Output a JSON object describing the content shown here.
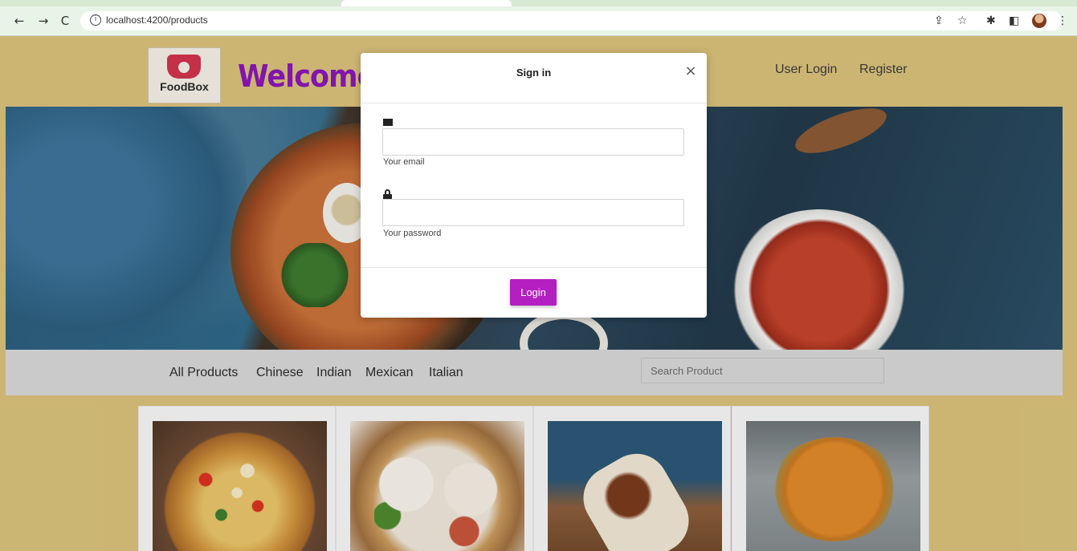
{
  "browser": {
    "back_icon": "arrow-left-icon",
    "forward_icon": "arrow-right-icon",
    "reload_icon": "reload-icon",
    "url": "localhost:4200/products",
    "share_icon": "share-icon",
    "bookmark_icon": "star-icon",
    "extensions_icon": "puzzle-icon",
    "sidepanel_icon": "sidepanel-icon",
    "menu_icon": "more-vertical-icon"
  },
  "header": {
    "logo_text": "FoodBox",
    "welcome": "Welcome",
    "nav": [
      "User Login",
      "Register"
    ]
  },
  "categories": [
    "All Products",
    "Chinese",
    "Indian",
    "Mexican",
    "Italian"
  ],
  "search": {
    "placeholder": "Search Product"
  },
  "products": [
    {
      "image": "pizza"
    },
    {
      "image": "momos"
    },
    {
      "image": "burrito"
    },
    {
      "image": "curry"
    }
  ],
  "modal": {
    "title": "Sign in",
    "close": "×",
    "email_label": "Your email",
    "password_label": "Your password",
    "login_button": "Login"
  },
  "colors": {
    "page_bg": "#d9c17b",
    "brand": "#8a17b7",
    "login_button": "#b41fc1",
    "browser_chrome": "#e9f4e8"
  }
}
